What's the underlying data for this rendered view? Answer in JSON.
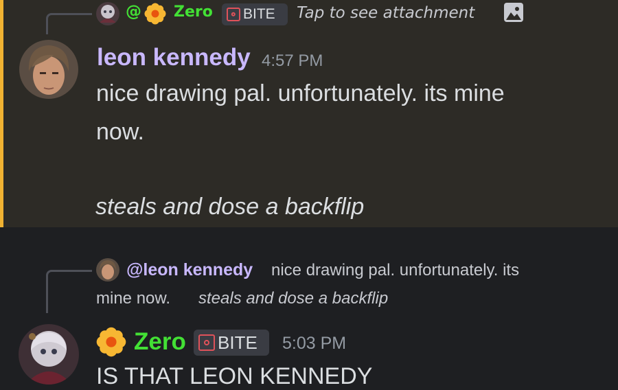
{
  "message_1": {
    "reply": {
      "mention": "@",
      "author": "Zero",
      "role_tag": "BITE",
      "preview": "Tap to see attachment"
    },
    "author": "leon kennedy",
    "timestamp": "4:57 PM",
    "body_line_1": "nice drawing pal. unfortunately. its mine",
    "body_line_2": "now.",
    "body_italic": "steals and dose a backflip",
    "colors": {
      "author": "#c9b8ff",
      "reply_author": "#43e035",
      "accent": "#f0b232",
      "background": "#2d2b26"
    }
  },
  "message_2": {
    "reply": {
      "author": "@leon kennedy",
      "preview_line_1": "nice drawing pal. unfortunately. its",
      "preview_line_2": "mine now.",
      "preview_italic": "steals and dose a backflip"
    },
    "author": "Zero",
    "role_tag": "BITE",
    "timestamp": "5:03 PM",
    "body_line_1": "IS THAT LEON KENNEDY",
    "colors": {
      "author": "#43e035",
      "reply_author": "#c9b8ff",
      "background": "#1e1f22"
    }
  },
  "icons": {
    "attachment": "image-icon",
    "role": "role-badge-icon",
    "flower": "flower-icon"
  }
}
